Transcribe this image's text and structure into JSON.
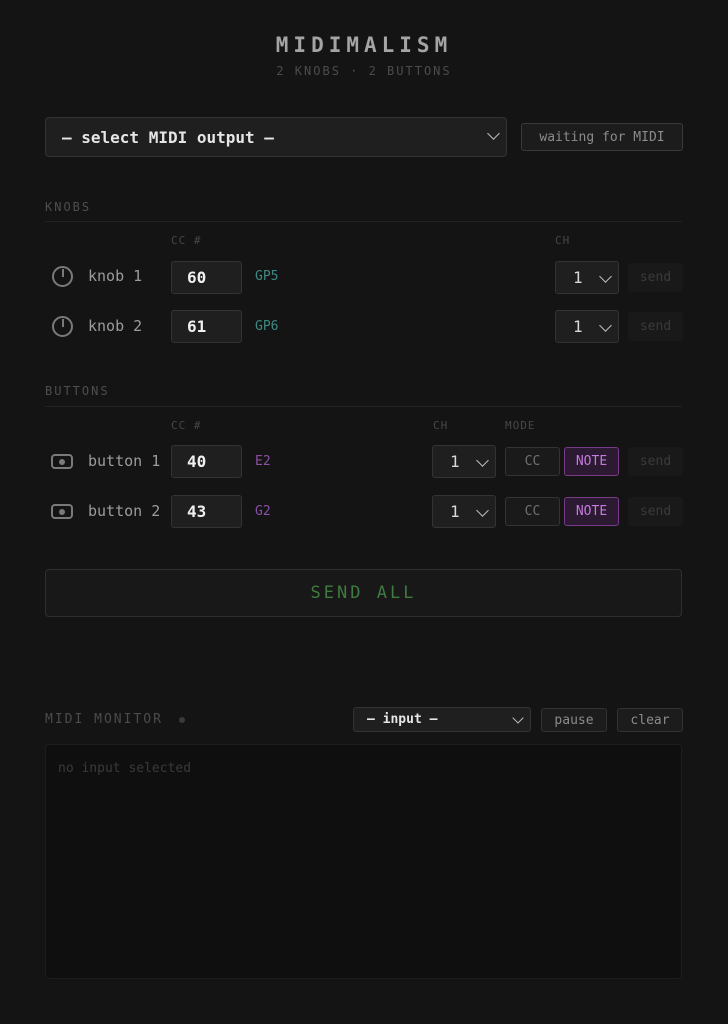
{
  "app": {
    "title": "MIDIMALISM",
    "subtitle": "2 KNOBS · 2 BUTTONS"
  },
  "output": {
    "selected": "— select MIDI output —",
    "status": "waiting for MIDI"
  },
  "knobs": {
    "section_label": "KNOBS",
    "col_cc": "CC #",
    "col_ch": "CH",
    "rows": [
      {
        "label": "knob 1",
        "cc": "60",
        "note": "GP5",
        "ch": "1",
        "send": "send"
      },
      {
        "label": "knob 2",
        "cc": "61",
        "note": "GP6",
        "ch": "1",
        "send": "send"
      }
    ]
  },
  "buttons": {
    "section_label": "BUTTONS",
    "col_cc": "CC #",
    "col_ch": "CH",
    "col_mode": "MODE",
    "rows": [
      {
        "label": "button 1",
        "cc": "40",
        "note": "E2",
        "ch": "1",
        "mode_cc": "CC",
        "mode_note": "NOTE",
        "send": "send"
      },
      {
        "label": "button 2",
        "cc": "43",
        "note": "G2",
        "ch": "1",
        "mode_cc": "CC",
        "mode_note": "NOTE",
        "send": "send"
      }
    ]
  },
  "send_all": "SEND ALL",
  "monitor": {
    "label": "MIDI MONITOR",
    "input_selected": "— input —",
    "pause": "pause",
    "clear": "clear",
    "empty_text": "no input selected"
  },
  "colors": {
    "knob_note": "#3e8a83",
    "button_note": "#8a4fa6",
    "send_all_text": "#3f7a3f",
    "note_mode_accent": "#c77ae0"
  },
  "icons": {
    "knob": "knob-icon",
    "button": "push-button-icon",
    "dropdown": "chevron-down-icon"
  }
}
